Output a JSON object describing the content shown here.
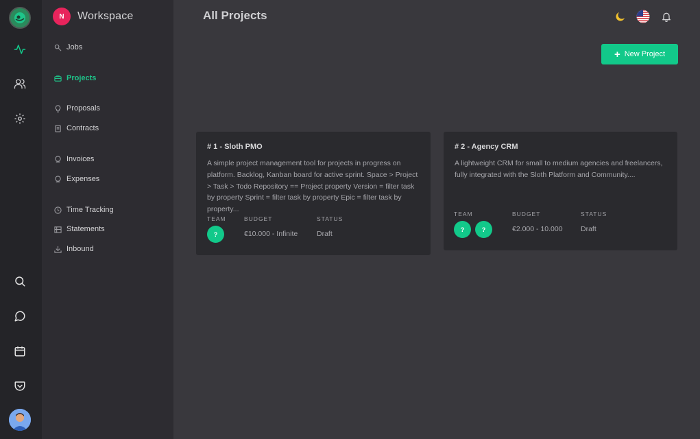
{
  "workspace": {
    "avatar_letter": "N",
    "title": "Workspace"
  },
  "sidebar": {
    "items": [
      {
        "label": "Jobs",
        "icon": "search-key-icon",
        "active": false
      },
      {
        "label": "Projects",
        "icon": "briefcase-icon",
        "active": true
      },
      {
        "label": "Proposals",
        "icon": "lightbulb-icon",
        "active": false
      },
      {
        "label": "Contracts",
        "icon": "document-icon",
        "active": false
      },
      {
        "label": "Invoices",
        "icon": "coin-icon",
        "active": false
      },
      {
        "label": "Expenses",
        "icon": "coin-icon",
        "active": false
      },
      {
        "label": "Time Tracking",
        "icon": "clock-icon",
        "active": false
      },
      {
        "label": "Statements",
        "icon": "building-icon",
        "active": false
      },
      {
        "label": "Inbound",
        "icon": "download-icon",
        "active": false
      }
    ]
  },
  "header": {
    "title": "All Projects"
  },
  "toolbar": {
    "new_project_label": "New Project"
  },
  "meta_labels": {
    "team": "TEAM",
    "budget": "BUDGET",
    "status": "STATUS"
  },
  "projects": [
    {
      "title": "# 1 - Sloth PMO",
      "description": "A simple project management tool for projects in progress on platform. Backlog, Kanban board for active sprint. Space > Project > Task > Todo Repository == Project property Version = filter task by property Sprint = filter task by property Epic = filter task by property...",
      "team": [
        "?"
      ],
      "budget": "€10.000 - Infinite",
      "status": "Draft"
    },
    {
      "title": "# 2 - Agency CRM",
      "description": "A lightweight CRM for small to medium agencies and freelancers, fully integrated with the Sloth Platform and Community....",
      "team": [
        "?",
        "?"
      ],
      "budget": "€2.000 - 10.000",
      "status": "Draft"
    }
  ],
  "colors": {
    "accent": "#12c98a",
    "workspace_avatar": "#e8245c",
    "background": "#39383d",
    "sidebar": "#2d2c31",
    "rail": "#242428"
  }
}
